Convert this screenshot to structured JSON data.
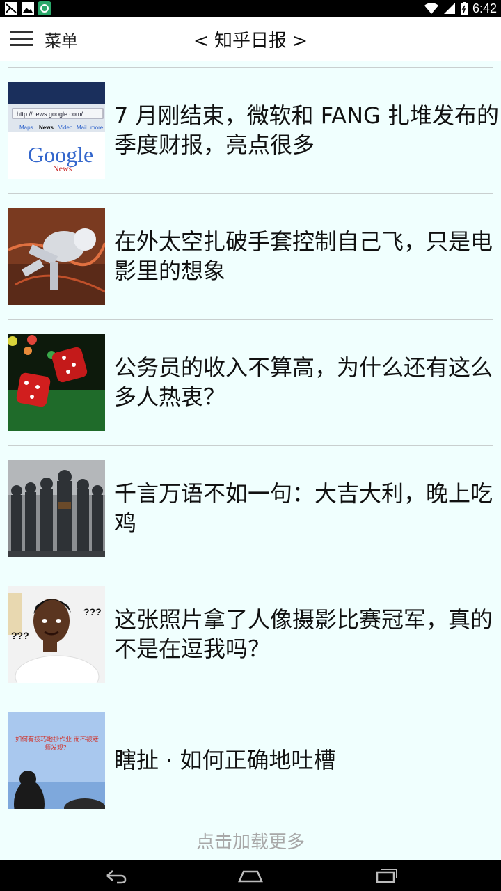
{
  "status_bar": {
    "time": "6:42"
  },
  "toolbar": {
    "menu_label": "菜单",
    "title": "< 知乎日报 >"
  },
  "articles": [
    {
      "title": "7 月刚结束，微软和 FANG 扎堆发布的季度财报，亮点很多"
    },
    {
      "title": "在外太空扎破手套控制自己飞，只是电影里的想象"
    },
    {
      "title": "公务员的收入不算高，为什么还有这么多人热衷？"
    },
    {
      "title": "千言万语不如一句：大吉大利，晚上吃鸡"
    },
    {
      "title": "这张照片拿了人像摄影比赛冠军，真的不是在逗我吗？"
    },
    {
      "title": "瞎扯 · 如何正确地吐槽"
    }
  ],
  "thumbnails": {
    "google_news": {
      "url_text": "http://news.google.com/",
      "tabs": [
        "Maps",
        "News",
        "Video",
        "Mail",
        "more"
      ],
      "logo": "Google",
      "sub": "News"
    },
    "meme": {
      "marks": "???"
    },
    "classroom": {
      "slide_text": "如何有技巧地抄作业 而不被老师发现？"
    }
  },
  "load_more": "点击加载更多",
  "colors": {
    "background": "#f0fffe",
    "toolbar": "#ffffff",
    "divider": "#c9cfcf",
    "load_more_text": "#a8a8a8"
  }
}
